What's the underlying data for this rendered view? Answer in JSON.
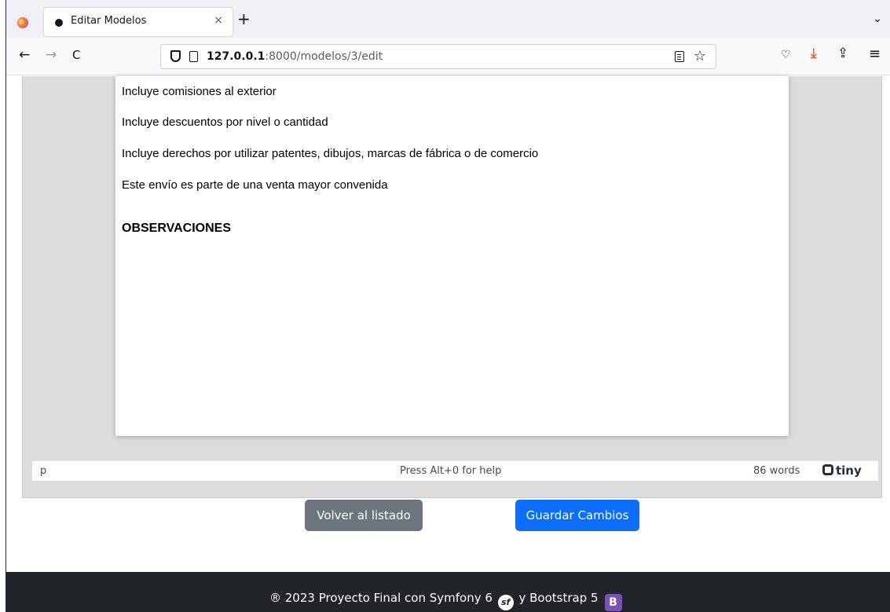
{
  "browser": {
    "tab": {
      "title": "Editar Modelos",
      "close": "×"
    },
    "new_tab": "+",
    "tab_list": "⌄",
    "nav": {
      "back": "←",
      "forward": "→",
      "reload": "C"
    },
    "url": {
      "host": "127.0.0.1",
      "rest": ":8000/modelos/3/edit"
    },
    "icons": {
      "star": "☆",
      "pocket": "♡",
      "download": "⤓",
      "extensions": "⇪",
      "menu": "≡"
    }
  },
  "editor": {
    "paragraphs": [
      "Incluye comisiones al exterior",
      "Incluye descuentos por nivel o cantidad",
      "Incluye derechos por utilizar patentes, dibujos, marcas de fábrica o de comercio",
      "Este envío es parte de una venta mayor  convenida"
    ],
    "heading": "OBSERVACIONES",
    "status": {
      "path": "p",
      "help": "Press Alt+0 for help",
      "words": "86 words",
      "brand": "tiny"
    }
  },
  "actions": {
    "back_label": "Volver al listado",
    "save_label": "Guardar Cambios"
  },
  "footer": {
    "text_1": "® 2023 Proyecto Final con Symfony 6",
    "symfony_logo": "sf",
    "text_2": "y Bootstrap 5",
    "bootstrap_logo": "B"
  },
  "colors": {
    "primary": "#0d6efd",
    "secondary": "#6c757d",
    "footer_bg": "#212529",
    "download_icon": "#e26b2f"
  }
}
